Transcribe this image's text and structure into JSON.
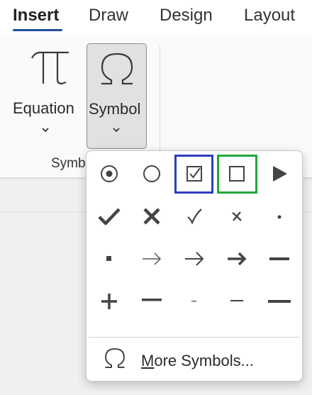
{
  "ribbon_tabs": [
    {
      "label": "Insert",
      "active": true
    },
    {
      "label": "Draw"
    },
    {
      "label": "Design"
    },
    {
      "label": "Layout"
    }
  ],
  "buttons": {
    "equation": {
      "label": "Equation",
      "icon": "pi-icon"
    },
    "symbol": {
      "label": "Symbol",
      "icon": "omega-icon"
    }
  },
  "group_label": "Symb",
  "symbol_gallery": {
    "rows": [
      [
        "radio-selected-icon",
        "radio-empty-icon",
        "checkbox-checked-icon",
        "checkbox-empty-icon",
        "play-triangle-icon"
      ],
      [
        "heavy-checkmark-icon",
        "heavy-x-icon",
        "light-checkmark-icon",
        "light-x-icon",
        "small-dot-icon"
      ],
      [
        "small-square-icon",
        "thin-arrow-icon",
        "medium-arrow-icon",
        "bold-arrow-icon",
        "dash-icon"
      ],
      [
        "plus-icon",
        "em-dash-icon",
        "hyphen-icon",
        "minus-icon",
        "long-dash-icon"
      ]
    ],
    "highlight_colors": {
      "blue": "#2e3dbf",
      "green": "#1fa83c"
    }
  },
  "more_symbols": {
    "first_letter": "M",
    "rest": "ore Symbols..."
  },
  "colors": {
    "accent": "#1f4e9c"
  }
}
